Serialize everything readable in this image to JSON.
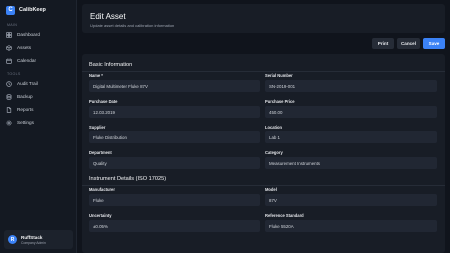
{
  "app": {
    "name": "CalibKeep",
    "logo_letter": "C"
  },
  "sidebar": {
    "main_label": "MAIN",
    "main_items": [
      {
        "label": "Dashboard",
        "icon": "grid-icon"
      },
      {
        "label": "Assets",
        "icon": "box-icon"
      },
      {
        "label": "Calendar",
        "icon": "calendar-icon"
      }
    ],
    "tools_label": "TOOLS",
    "tools_items": [
      {
        "label": "Audit Trail",
        "icon": "history-icon"
      },
      {
        "label": "Backup",
        "icon": "database-icon"
      },
      {
        "label": "Reports",
        "icon": "document-icon"
      },
      {
        "label": "Settings",
        "icon": "gear-icon"
      }
    ]
  },
  "user": {
    "initial": "R",
    "name": "RuffStack",
    "subtitle": "Company Admin"
  },
  "header": {
    "title": "Edit Asset",
    "subtitle": "Update asset details and calibration information"
  },
  "toolbar": {
    "print_label": "Print",
    "cancel_label": "Cancel",
    "save_label": "Save"
  },
  "form": {
    "basic": {
      "title": "Basic Information",
      "fields": [
        {
          "label": "Name *",
          "value": "Digital Multimeter Fluke 87V"
        },
        {
          "label": "Serial Number",
          "value": "SN-2019-001"
        },
        {
          "label": "Purchase Date",
          "value": "12.03.2019"
        },
        {
          "label": "Purchase Price",
          "value": "450.00"
        },
        {
          "label": "Supplier",
          "value": "Fluke Distribution"
        },
        {
          "label": "Location",
          "value": "Lab 1"
        },
        {
          "label": "Department",
          "value": "Quality"
        },
        {
          "label": "Category",
          "value": "Measurement Instruments"
        }
      ]
    },
    "instrument": {
      "title": "Instrument Details (ISO 17025)",
      "fields": [
        {
          "label": "Manufacturer",
          "value": "Fluke"
        },
        {
          "label": "Model",
          "value": "87V"
        },
        {
          "label": "Uncertainty",
          "value": "±0.05%"
        },
        {
          "label": "Reference Standard",
          "value": "Fluke 5520A"
        }
      ]
    }
  }
}
